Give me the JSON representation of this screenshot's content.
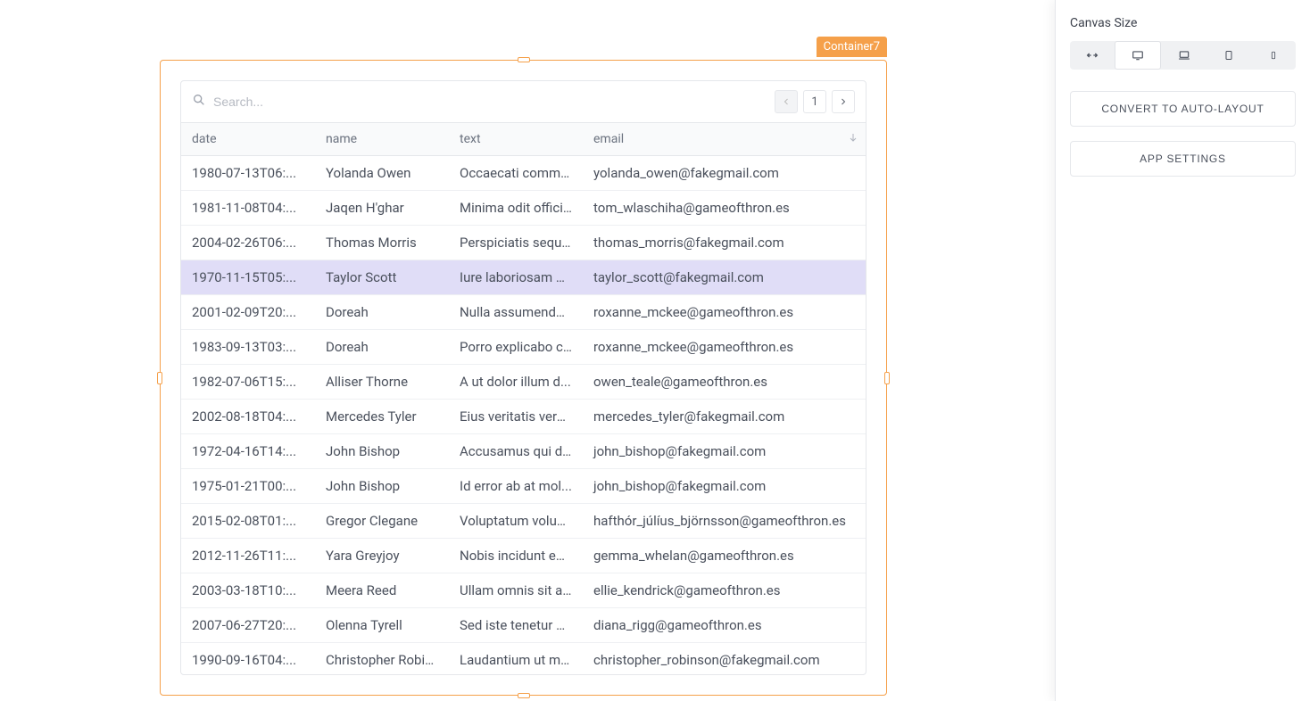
{
  "selection": {
    "label": "Container7"
  },
  "search": {
    "placeholder": "Search..."
  },
  "pagination": {
    "page": "1"
  },
  "columns": [
    {
      "key": "date",
      "label": "date"
    },
    {
      "key": "name",
      "label": "name"
    },
    {
      "key": "text",
      "label": "text"
    },
    {
      "key": "email",
      "label": "email",
      "sorted": "desc"
    }
  ],
  "rows": [
    {
      "date": "1980-07-13T06:...",
      "name": "Yolanda Owen",
      "text": "Occaecati commo...",
      "email": "yolanda_owen@fakegmail.com",
      "highlight": false
    },
    {
      "date": "1981-11-08T04:...",
      "name": "Jaqen H'ghar",
      "text": "Minima odit officii...",
      "email": "tom_wlaschiha@gameofthron.es",
      "highlight": false
    },
    {
      "date": "2004-02-26T06:...",
      "name": "Thomas Morris",
      "text": "Perspiciatis sequi ...",
      "email": "thomas_morris@fakegmail.com",
      "highlight": false
    },
    {
      "date": "1970-11-15T05:...",
      "name": "Taylor Scott",
      "text": "Iure laboriosam q...",
      "email": "taylor_scott@fakegmail.com",
      "highlight": true
    },
    {
      "date": "2001-02-09T20:...",
      "name": "Doreah",
      "text": "Nulla assumenda ...",
      "email": "roxanne_mckee@gameofthron.es",
      "highlight": false
    },
    {
      "date": "1983-09-13T03:...",
      "name": "Doreah",
      "text": "Porro explicabo c...",
      "email": "roxanne_mckee@gameofthron.es",
      "highlight": false
    },
    {
      "date": "1982-07-06T15:...",
      "name": "Alliser Thorne",
      "text": "A ut dolor illum d...",
      "email": "owen_teale@gameofthron.es",
      "highlight": false
    },
    {
      "date": "2002-08-18T04:...",
      "name": "Mercedes Tyler",
      "text": "Eius veritatis vero ...",
      "email": "mercedes_tyler@fakegmail.com",
      "highlight": false
    },
    {
      "date": "1972-04-16T14:...",
      "name": "John Bishop",
      "text": "Accusamus qui di...",
      "email": "john_bishop@fakegmail.com",
      "highlight": false
    },
    {
      "date": "1975-01-21T00:...",
      "name": "John Bishop",
      "text": "Id error ab at mol...",
      "email": "john_bishop@fakegmail.com",
      "highlight": false
    },
    {
      "date": "2015-02-08T01:...",
      "name": "Gregor Clegane",
      "text": "Voluptatum volup...",
      "email": "hafthór_júlíus_björnsson@gameofthron.es",
      "highlight": false
    },
    {
      "date": "2012-11-26T11:...",
      "name": "Yara Greyjoy",
      "text": "Nobis incidunt ea ...",
      "email": "gemma_whelan@gameofthron.es",
      "highlight": false
    },
    {
      "date": "2003-03-18T10:...",
      "name": "Meera Reed",
      "text": "Ullam omnis sit a...",
      "email": "ellie_kendrick@gameofthron.es",
      "highlight": false
    },
    {
      "date": "2007-06-27T20:...",
      "name": "Olenna Tyrell",
      "text": "Sed iste tenetur u...",
      "email": "diana_rigg@gameofthron.es",
      "highlight": false
    },
    {
      "date": "1990-09-16T04:...",
      "name": "Christopher Robin...",
      "text": "Laudantium ut mo...",
      "email": "christopher_robinson@fakegmail.com",
      "highlight": false
    }
  ],
  "sidebar": {
    "title": "Canvas Size",
    "viewports": [
      {
        "name": "auto",
        "active": false
      },
      {
        "name": "desktop",
        "active": true
      },
      {
        "name": "laptop",
        "active": false
      },
      {
        "name": "tablet",
        "active": false
      },
      {
        "name": "mobile",
        "active": false
      }
    ],
    "buttons": {
      "convert": "CONVERT TO AUTO-LAYOUT",
      "settings": "APP SETTINGS"
    }
  }
}
